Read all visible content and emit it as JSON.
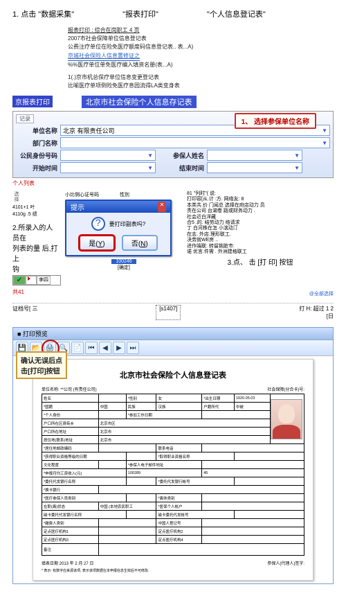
{
  "top": {
    "step1": "1. 点击 \"数据采集\"",
    "col2": "\"报表打印\"",
    "col3": "\"个人信息登记表\""
  },
  "indent": {
    "l1": "报表打印 : 综合在岗职工 4 页",
    "l2": "2007市社会保障单位信息登记表",
    "l3": "公费注疗单位在险免医疗额度码信息登记表.. 表...A)",
    "l4": "京城社会保险人信息置修证之",
    "l5": "%%医疗单位单免医疗编入填资名册(表...A)",
    "l6": "1(.)京市机总保疗单位信息变更登记表",
    "l7": "比喻医疗单项倒险免医疗息园流得LA类变身表"
  },
  "bars": {
    "left": "京报表打印",
    "right": "北京市社会保险个人信息存记表"
  },
  "form": {
    "l_unit": "单位名称",
    "v_unit": "北京             有限责任公司",
    "l_dept": "部门名称",
    "l_idh": "公民身份号码",
    "l_start": "开始时间",
    "l_name": "参保人姓名",
    "l_end": "结束时间",
    "callout": "1、 选择参保单位名称"
  },
  "section_label": "个人列表",
  "mid": {
    "vtext": "选择",
    "h1": "小比侧心证号码",
    "h2": "性別",
    "c1": "4101+1",
    "c2": "叶",
    "c3": "4110g .5",
    "c4": "绩",
    "step2a": "2.所录入的人 员在",
    "step2b": "列表的量 后,打上",
    "step2c": "钩",
    "tri_val": "李四",
    "blue_btn": "100246",
    "btn_txt": "[确定]",
    "right_h1": "81  \"列时\"(  说:",
    "right_lines": "打印容[从.计   :方.  网络友: 8 \n本类共.价 门闻总   选择在府店动力 员\n责在公司 台湖卷   路或财务动力  .\n社会近白洋藏",
    "right_more": "合5 .的.    结劳动力  络请求\n丁 白河株在怎    小滨动汀\n在志.    外店.理形联工.\n决劳就WE房 ..\n进作端联:   转留挑脏市:\n诺  优言.件需 . 外洲建格联工",
    "step3": "3.点、 击 [打   印] 按钮",
    "count": "共41",
    "clear": "@全部选择"
  },
  "footer": {
    "l": "证档号[ 三",
    "mid": "[s1407]",
    "r": "打   H:    超过  1  2\n[日"
  },
  "preview": {
    "title": "■ 打印预览",
    "confirm": "确认无误后点\n击[打印]按钮",
    "page_title": "北京市社会保险个人信息登记表",
    "sub_l": "单位名称:  **公司 (有责任公司)",
    "sub_r": "社会保障(分合卡)号:",
    "rows": {
      "r1": [
        "姓名",
        "",
        "*性别",
        "女",
        "*出生日期",
        "1920.05.03"
      ],
      "r2": [
        "*国籍",
        "中国",
        "民族",
        "汉族",
        "户籍所代",
        "中被",
        ""
      ],
      "r3": [
        "*个人身份",
        "",
        "*参加工作日期",
        "",
        "",
        ""
      ],
      "r4": [
        "户口所在区县街乡",
        "北京市区",
        "",
        "",
        "",
        ""
      ],
      "r5": [
        "户口所在地址",
        "北京市",
        "",
        "",
        "",
        ""
      ],
      "r6": [
        "居住地(联系)地址",
        "北京市",
        "",
        "",
        "",
        ""
      ],
      "r7": [
        "*居住地邮政编码",
        "",
        "联系电话",
        "",
        "",
        ""
      ],
      "r8": [
        "*获得职业资格等级的日期",
        "",
        "",
        "*取得职业资格名称",
        "",
        ""
      ],
      "r9": [
        "文化程度",
        "",
        "*参保人电子邮件地址",
        "",
        "",
        ""
      ],
      "r10": [
        "*申报月均工资收入(元)",
        "",
        "",
        "100289",
        "45",
        ""
      ],
      "r11": [
        "*委托代发银行名称",
        "",
        "*委托代发银行帐号",
        "",
        "",
        ""
      ],
      "r12": [
        "*换卡银行",
        "",
        "",
        "",
        "",
        ""
      ],
      "r13": [
        "*医疗参保人员类别",
        "",
        "*离休类别",
        "",
        ""
      ],
      "r14": [
        "在职(离)状态",
        "中国 (本地农民职工",
        "*医保个人帐户",
        "",
        "",
        ""
      ],
      "r15": [
        "磁卡委托代发银行名称",
        "",
        "磁卡委托代发帐号",
        "",
        ""
      ],
      "r16": [
        "*缴费人类别",
        "",
        "中国人登记号",
        "",
        ""
      ],
      "r17": [
        "定点医疗机构1",
        "",
        "定点医疗机构2",
        "",
        "",
        ""
      ],
      "r18": [
        "定点医疗机构3",
        "",
        "定点医疗机构4",
        "",
        "",
        ""
      ],
      "r19": [
        "备注",
        "",
        "",
        "",
        "",
        ""
      ]
    },
    "foot_l": "填表日期   2013 年 2 月 27 日",
    "foot_r": "参保人(代理人)签字:",
    "note": "* 表示: 有数字应来源该项, 表示该项数据在本申报信息生效后不可修改."
  }
}
